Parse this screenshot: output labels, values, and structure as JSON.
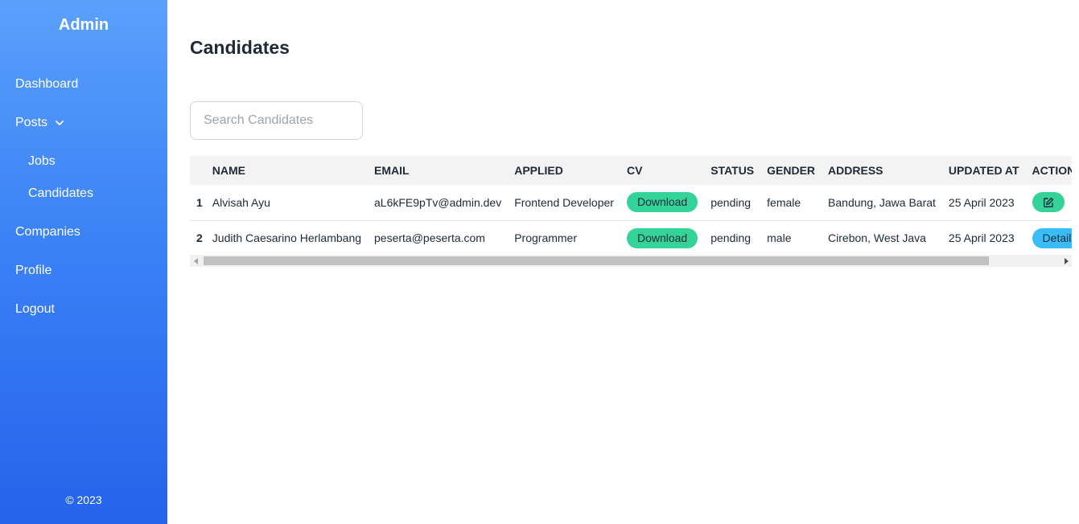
{
  "sidebar": {
    "brand": "Admin",
    "items": [
      {
        "label": "Dashboard"
      },
      {
        "label": "Posts"
      },
      {
        "label": "Jobs"
      },
      {
        "label": "Candidates"
      },
      {
        "label": "Companies"
      },
      {
        "label": "Profile"
      },
      {
        "label": "Logout"
      }
    ],
    "copyright": "© 2023"
  },
  "main": {
    "title": "Candidates",
    "search": {
      "placeholder": "Search Candidates",
      "value": ""
    },
    "table": {
      "headers": [
        "",
        "NAME",
        "EMAIL",
        "APPLIED",
        "CV",
        "STATUS",
        "GENDER",
        "ADDRESS",
        "UPDATED AT",
        "ACTION"
      ],
      "rows": [
        {
          "no": "1",
          "name": "Alvisah Ayu",
          "email": "aL6kFE9pTv@admin.dev",
          "applied": "Frontend Developer",
          "cv": "Download",
          "status": "pending",
          "gender": "female",
          "address": "Bandung, Jawa Barat",
          "updated_at": "25 April 2023"
        },
        {
          "no": "2",
          "name": "Judith Caesarino Herlambang",
          "email": "peserta@peserta.com",
          "applied": "Programmer",
          "cv": "Download",
          "status": "pending",
          "gender": "male",
          "address": "Cirebon, West Java",
          "updated_at": "25 April 2023",
          "action": "Details"
        }
      ]
    }
  },
  "colors": {
    "sidebar_top": "#5aa0fb",
    "sidebar_bottom": "#2563eb",
    "download": "#34d399",
    "details": "#38bdf8",
    "delete": "#f87171"
  }
}
